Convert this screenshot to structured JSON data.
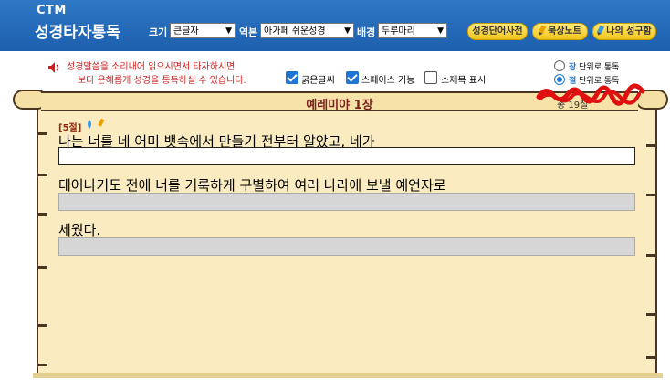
{
  "header": {
    "logo_top": "CTM",
    "logo_main": "성경타자통독",
    "size_label": "크기",
    "size_value": "큰글자",
    "version_label": "역본",
    "version_value": "아가페 쉬운성경",
    "background_label": "배경",
    "background_value": "두루마리",
    "btn_dictionary": "성경단어사전",
    "btn_meditation": "묵상노트",
    "btn_my_verses": "나의 성구함",
    "accent_color": "#2f78c6"
  },
  "options": {
    "notice_line1": "성경말씀을 소리내어 읽으시면서 타자하시면",
    "notice_line2": "보다 은혜롭게 성경을 통독하실 수 있습니다.",
    "bold_label": "굵은글씨",
    "bold_checked": true,
    "space_label": "스페이스 기능",
    "space_checked": true,
    "subtitle_label": "소제목 표시",
    "subtitle_checked": false,
    "radio_chapter_prefix": "장",
    "radio_chapter_suffix": "단위로 통독",
    "radio_verse_prefix": "절",
    "radio_verse_suffix": "단위로 통독",
    "selected_mode": "verse"
  },
  "scroll": {
    "title": "예레미야 1장",
    "progress": "총 19절"
  },
  "verse": {
    "tag": "[5절]",
    "lines": [
      "나는 너를 네 어미 뱃속에서 만들기 전부터 알았고, 네가",
      "태어나기도 전에 너를 거룩하게 구별하여 여러 나라에 보낼 예언자로",
      "세웠다."
    ]
  }
}
